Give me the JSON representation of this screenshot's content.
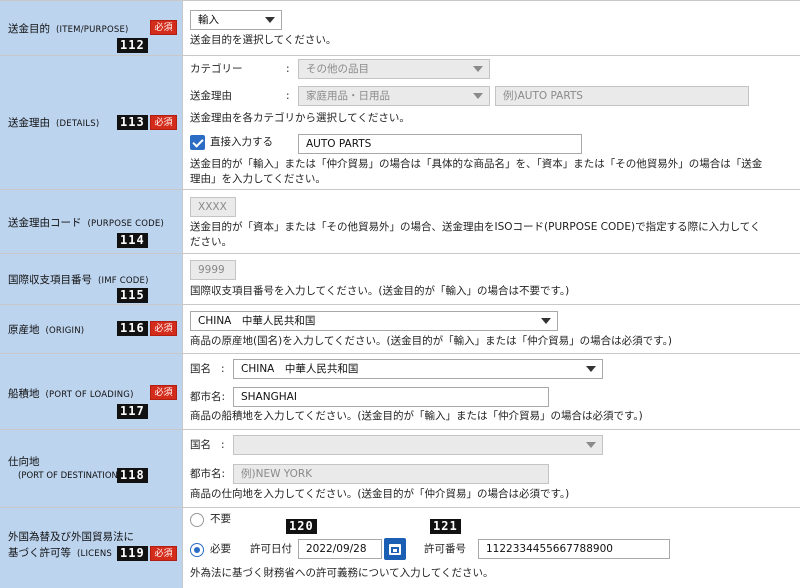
{
  "rows": {
    "purpose": {
      "label": "送金目的",
      "label_en": "(ITEM/PURPOSE)",
      "num": "112",
      "required": "必須",
      "select": "輸入",
      "help": "送金目的を選択してください。"
    },
    "details": {
      "label": "送金理由",
      "label_en": "(DETAILS)",
      "num": "113",
      "required": "必須",
      "category_label": "カテゴリー",
      "colon": ":",
      "category_value": "その他の品目",
      "reason_label": "送金理由",
      "reason_value": "家庭用品・日用品",
      "reason_placeholder": "例)AUTO PARTS",
      "help1": "送金理由を各カテゴリから選択してください。",
      "direct_label": "直接入力する",
      "direct_value": "AUTO PARTS",
      "help2a": "送金目的が「輸入」または「仲介貿易」の場合は「具体的な商品名」を、「資本」または「その他貿易外」の場合は「送金",
      "help2b": "理由」を入力してください。"
    },
    "purpose_code": {
      "label": "送金理由コード",
      "label_en": "(PURPOSE CODE)",
      "num": "114",
      "placeholder": "XXXX",
      "help_a": "送金目的が「資本」または「その他貿易外」の場合、送金理由をISOコード(PURPOSE CODE)で指定する際に入力してく",
      "help_b": "ださい。"
    },
    "imf": {
      "label": "国際収支項目番号",
      "label_en": "(IMF CODE)",
      "num": "115",
      "placeholder": "9999",
      "help": "国際収支項目番号を入力してください。(送金目的が「輸入」の場合は不要です。)"
    },
    "origin": {
      "label": "原産地",
      "label_en": "(ORIGIN)",
      "num": "116",
      "required": "必須",
      "select": "CHINA　中華人民共和国",
      "help": "商品の原産地(国名)を入力してください。(送金目的が「輸入」または「仲介貿易」の場合は必須です。)"
    },
    "loading": {
      "label": "船積地",
      "label_en": "(PORT OF LOADING)",
      "num": "117",
      "required": "必須",
      "country_label": "国名",
      "colon": ":",
      "country_value": "CHINA　中華人民共和国",
      "city_label": "都市名:",
      "city_value": "SHANGHAI",
      "help": "商品の船積地を入力してください。(送金目的が「輸入」または「仲介貿易」の場合は必須です。)"
    },
    "destination": {
      "label": "仕向地",
      "label_en": "(PORT OF DESTINATION)",
      "num": "118",
      "country_label": "国名",
      "colon": ":",
      "country_value": "",
      "city_label": "都市名:",
      "city_placeholder": "例)NEW YORK",
      "help": "商品の仕向地を入力してください。(送金目的が「仲介貿易」の場合は必須です。)"
    },
    "license": {
      "label_line1": "外国為替及び外国貿易法に",
      "label_line2": "基づく許可等",
      "label_en": "(LICENS",
      "num": "119",
      "required": "必須",
      "option_no": "不要",
      "option_yes": "必要",
      "num_date": "120",
      "date_label": "許可日付",
      "date_value": "2022/09/28",
      "num_license": "121",
      "license_label": "許可番号",
      "license_value": "1122334455667788900",
      "help": "外為法に基づく財務省への許可義務について入力してください。"
    }
  },
  "colors": {
    "label_bg": "#bdd4ef",
    "required": "#d42c1b",
    "accent": "#2b6cc4"
  }
}
